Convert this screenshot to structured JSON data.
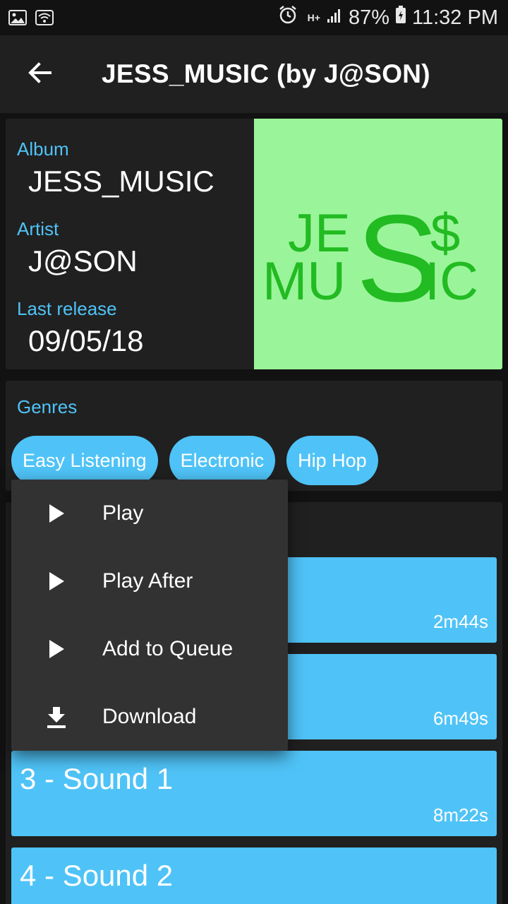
{
  "status_bar": {
    "battery": "87%",
    "time": "11:32 PM",
    "network": "H+"
  },
  "app_bar": {
    "title": "JESS_MUSIC (by J@SON)"
  },
  "info": {
    "album_label": "Album",
    "album_value": "JESS_MUSIC",
    "artist_label": "Artist",
    "artist_value": "J@SON",
    "release_label": "Last release",
    "release_value": "09/05/18",
    "cover": {
      "line1": "JE",
      "line2": "MU",
      "big_s": "S",
      "dollar": "$",
      "ic": "IC",
      "bg_color": "#9af59a",
      "fg_color": "#22bb22"
    }
  },
  "genres": {
    "label": "Genres",
    "chips": [
      "Easy Listening",
      "Electronic",
      "Hip Hop"
    ]
  },
  "tracks": [
    {
      "title": "",
      "duration": "2m44s"
    },
    {
      "title": "",
      "duration": "6m49s"
    },
    {
      "title": "3 - Sound 1",
      "duration": "8m22s"
    },
    {
      "title": "4 - Sound 2",
      "duration": ""
    }
  ],
  "menu": {
    "items": [
      {
        "label": "Play",
        "icon": "play-icon"
      },
      {
        "label": "Play After",
        "icon": "play-icon"
      },
      {
        "label": "Add to Queue",
        "icon": "play-icon"
      },
      {
        "label": "Download",
        "icon": "download-icon"
      }
    ]
  },
  "colors": {
    "accent": "#4fc3f7",
    "card": "#202020",
    "background": "#121212",
    "menu": "#323232"
  }
}
